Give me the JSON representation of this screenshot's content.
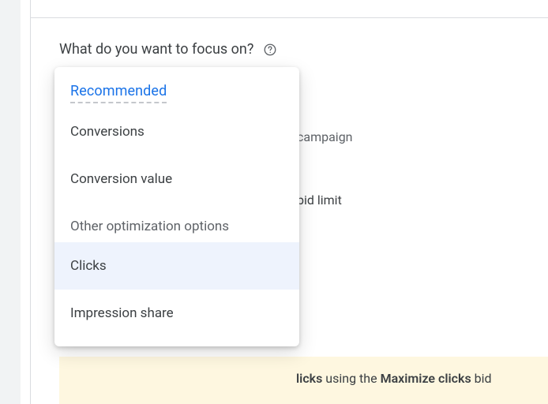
{
  "prompt": "What do you want to focus on?",
  "background": {
    "line_a_fragment": "campaign",
    "line_b_fragment": "bid limit"
  },
  "info_strip": {
    "lead_fragment": "licks",
    "mid_text": "using the",
    "strategy": "Maximize clicks",
    "trail_fragment": "bid"
  },
  "dropdown": {
    "recommended_header": "Recommended",
    "section_header": "Other optimization options",
    "items": {
      "conversions": "Conversions",
      "conversion_value": "Conversion value",
      "clicks": "Clicks",
      "impression_share": "Impression share"
    }
  }
}
